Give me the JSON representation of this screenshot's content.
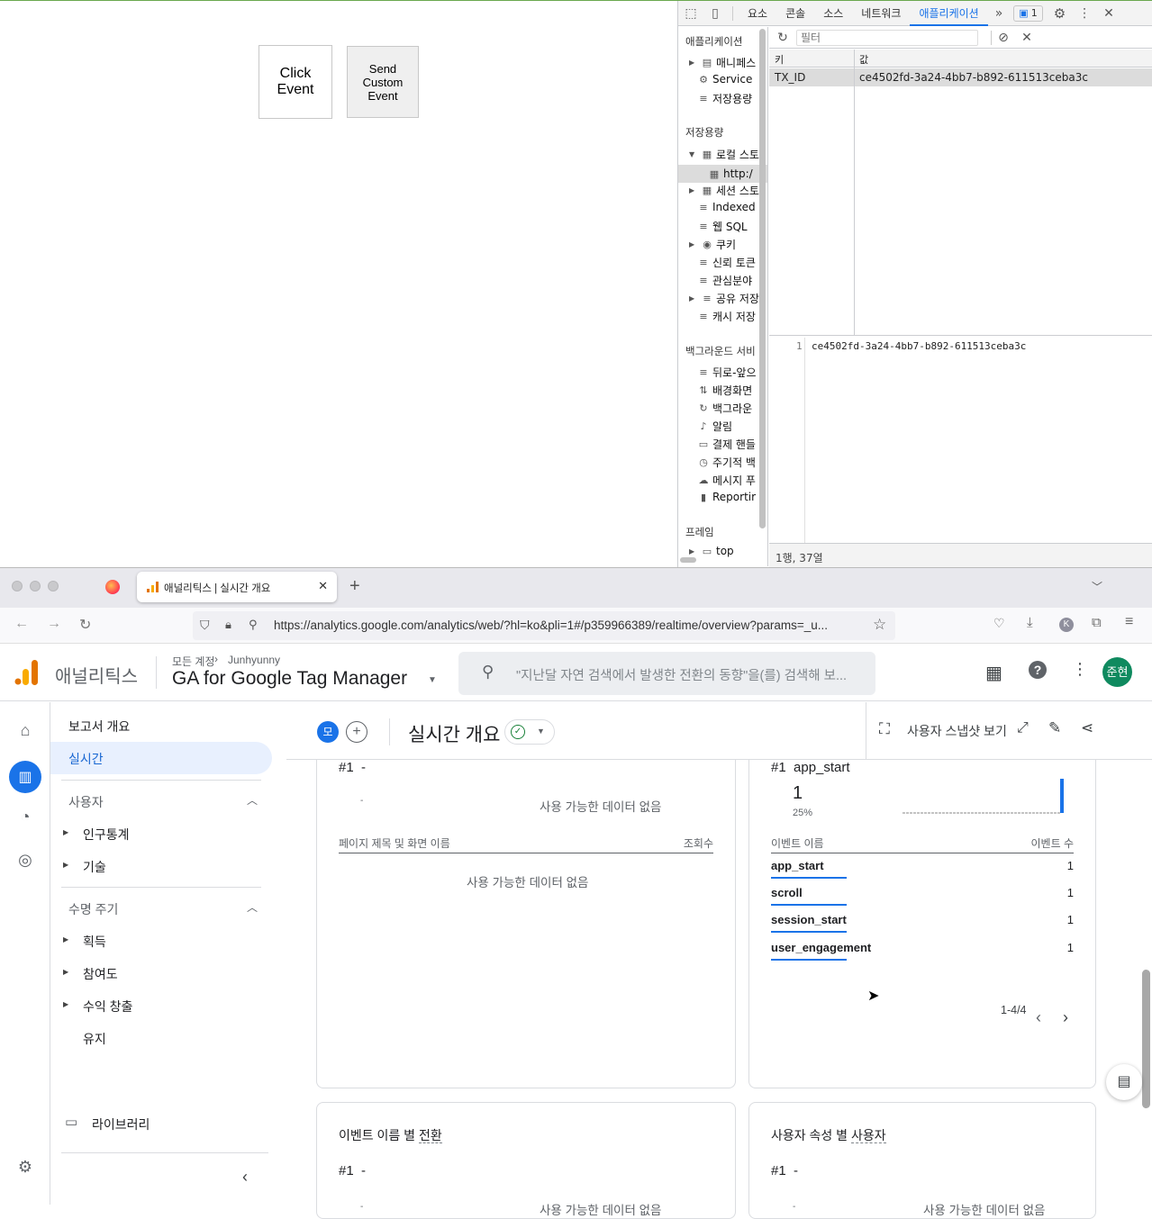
{
  "page": {
    "click_button": "Click\nEvent",
    "custom_button": "Send\nCustom\nEvent"
  },
  "devtools": {
    "tabs": [
      "요소",
      "콘솔",
      "소스",
      "네트워크",
      "애플리케이션"
    ],
    "more": "»",
    "badge_count": "1",
    "sidebar": {
      "app_header": "애플리케이션",
      "app_items": [
        "매니페스",
        "Service",
        "저장용량"
      ],
      "storage_header": "저장용량",
      "storage_items": [
        "로컬 스토",
        "http:/",
        "세션 스토",
        "Indexed",
        "웹 SQL",
        "쿠키",
        "신뢰 토큰",
        "관심분야",
        "공유 저장",
        "캐시 저장"
      ],
      "bg_header": "백그라운드 서비",
      "bg_items": [
        "뒤로-앞으",
        "배경화면",
        "백그라운",
        "알림",
        "결제 핸들",
        "주기적 백",
        "메시지 푸",
        "Reportir"
      ],
      "frame_header": "프레임",
      "frame_item": "top"
    },
    "filter_placeholder": "필터",
    "table": {
      "col_key": "키",
      "col_value": "값",
      "rows": [
        {
          "key": "TX_ID",
          "value": "ce4502fd-3a24-4bb7-b892-611513ceba3c"
        }
      ]
    },
    "preview": {
      "line_no": "1",
      "text": "ce4502fd-3a24-4bb7-b892-611513ceba3c"
    },
    "status": "1행, 37열"
  },
  "browser": {
    "tab_title": "애널리틱스 | 실시간 개요",
    "url": "https://analytics.google.com/analytics/web/?hl=ko&pli=1#/p359966389/realtime/overview?params=_u...",
    "profile_initial": "K"
  },
  "ga": {
    "brand": "애널리틱스",
    "breadcrumb_all": "모든 계정",
    "breadcrumb_account": "Junhyunny",
    "property": "GA for Google Tag Manager",
    "search_placeholder": "\"지난달 자연 검색에서 발생한 전환의 동향\"을(를) 검색해 보...",
    "avatar": "준현",
    "nav": {
      "reports_overview": "보고서 개요",
      "realtime": "실시간",
      "user_section": "사용자",
      "demographics": "인구통계",
      "tech": "기술",
      "lifecycle_section": "수명 주기",
      "acquisition": "획득",
      "engagement": "참여도",
      "monetization": "수익 창출",
      "retention": "유지",
      "library": "라이브러리"
    },
    "toolbar": {
      "compare_chip": "모",
      "title": "실시간 개요",
      "snapshot": "사용자 스냅샷 보기"
    },
    "card_pages": {
      "rank": "#1  -",
      "dash": "-",
      "no_data_top": "사용 가능한 데이터 없음",
      "col_name": "페이지 제목 및 화면 이름",
      "col_views": "조회수",
      "no_data": "사용 가능한 데이터 없음"
    },
    "card_events": {
      "rank": "#1  app_start",
      "count": "1",
      "percent": "25%",
      "col_name": "이벤트 이름",
      "col_count": "이벤트 수",
      "rows": [
        {
          "name": "app_start",
          "value": "1"
        },
        {
          "name": "scroll",
          "value": "1"
        },
        {
          "name": "session_start",
          "value": "1"
        },
        {
          "name": "user_engagement",
          "value": "1"
        }
      ],
      "pagination": "1-4/4"
    },
    "card_conversions": {
      "title_prefix": "이벤트 이름 별 ",
      "title_link": "전환",
      "rank": "#1  -",
      "dash": "-",
      "no_data": "사용 가능한 데이터 없음"
    },
    "card_user_prop": {
      "title_prefix": "사용자 속성 별 ",
      "title_link": "사용자",
      "rank": "#1  -",
      "dash": "-",
      "no_data": "사용 가능한 데이터 없음"
    }
  }
}
